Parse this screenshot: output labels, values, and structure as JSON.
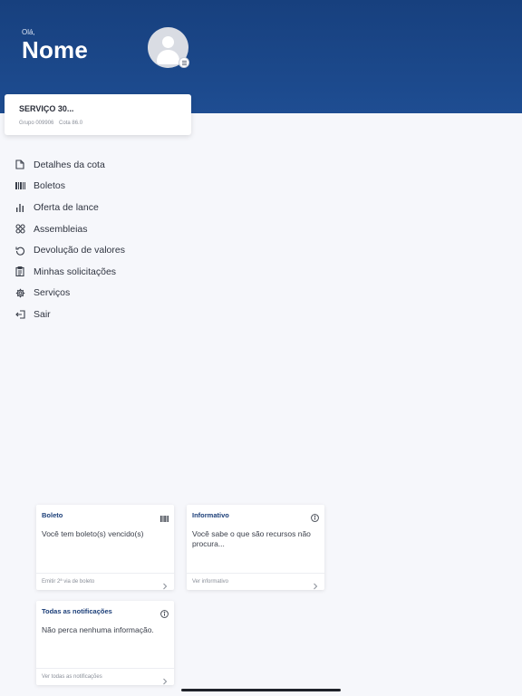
{
  "header": {
    "greeting": "Olá,",
    "name": "Nome",
    "background_color": "#1e4a8c"
  },
  "avatar": {
    "icon": "user-avatar-icon",
    "badge_icon": "menu-icon"
  },
  "quota_card": {
    "title": "SERVIÇO 30...",
    "group": "Grupo 009906",
    "quota": "Cota 86.0"
  },
  "menu": {
    "items": [
      {
        "label": "Detalhes da cota",
        "icon": "document-icon"
      },
      {
        "label": "Boletos",
        "icon": "barcode-icon"
      },
      {
        "label": "Oferta de lance",
        "icon": "bar-chart-icon"
      },
      {
        "label": "Assembleias",
        "icon": "people-group-icon"
      },
      {
        "label": "Devolução de valores",
        "icon": "refund-icon"
      },
      {
        "label": "Minhas solicitações",
        "icon": "clipboard-icon"
      },
      {
        "label": "Serviços",
        "icon": "gear-icon"
      },
      {
        "label": "Sair",
        "icon": "logout-icon"
      }
    ]
  },
  "cards": {
    "boleto": {
      "title": "Boleto",
      "text": "Você tem boleto(s) vencido(s)",
      "link": "Emitir 2ª via de boleto",
      "icon": "barcode-icon"
    },
    "informativo": {
      "title": "Informativo",
      "text": "Você sabe o que são recursos não procura...",
      "link": "Ver informativo",
      "icon": "info-icon"
    },
    "notificacoes": {
      "title": "Todas as notificações",
      "text": "Não perca nenhuma informação.",
      "link": "Ver todas as notificações",
      "icon": "info-icon"
    }
  },
  "colors": {
    "accent": "#1b3e78",
    "background": "#f6f7fb"
  }
}
